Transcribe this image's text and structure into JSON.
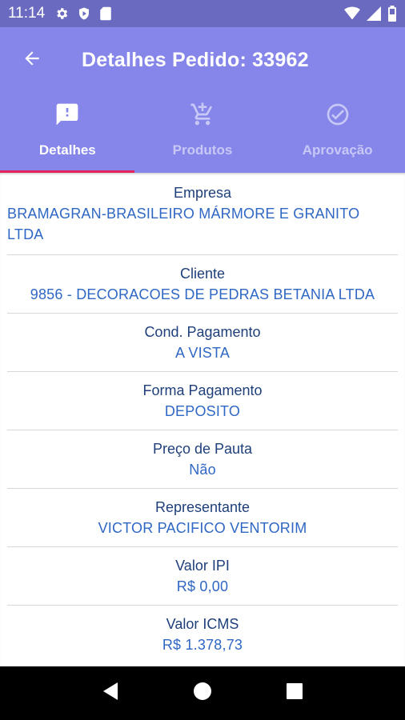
{
  "status_bar": {
    "time": "11:14",
    "left_icons": [
      "gear-icon",
      "shield-play-icon",
      "sd-card-icon"
    ],
    "right_icons": [
      "wifi-icon",
      "signal-icon",
      "battery-icon"
    ]
  },
  "app_bar": {
    "back_icon": "arrow-left-icon",
    "title": "Detalhes Pedido: 33962"
  },
  "tabs": [
    {
      "label": "Detalhes",
      "icon": "feedback-icon",
      "active": true
    },
    {
      "label": "Produtos",
      "icon": "cart-add-icon",
      "active": false
    },
    {
      "label": "Aprovação",
      "icon": "check-circle-icon",
      "active": false
    }
  ],
  "fields": [
    {
      "label": "Empresa",
      "value": "BRAMAGRAN-BRASILEIRO MÁRMORE E GRANITO LTDA"
    },
    {
      "label": "Cliente",
      "value": "9856 - DECORACOES DE PEDRAS BETANIA LTDA"
    },
    {
      "label": "Cond. Pagamento",
      "value": "A VISTA"
    },
    {
      "label": "Forma Pagamento",
      "value": "DEPOSITO"
    },
    {
      "label": "Preço de Pauta",
      "value": "Não"
    },
    {
      "label": "Representante",
      "value": "VICTOR PACIFICO VENTORIM"
    },
    {
      "label": "Valor IPI",
      "value": "R$ 0,00"
    },
    {
      "label": "Valor ICMS",
      "value": "R$ 1.378,73"
    }
  ],
  "colors": {
    "status_bar": "#6a6ac0",
    "app_bar": "#8585ea",
    "tab_indicator": "#e2245c",
    "label_text": "#1f3f7a",
    "value_text": "#2f67c4"
  },
  "nav_bar": [
    "back-triangle-icon",
    "home-circle-icon",
    "recents-square-icon"
  ]
}
